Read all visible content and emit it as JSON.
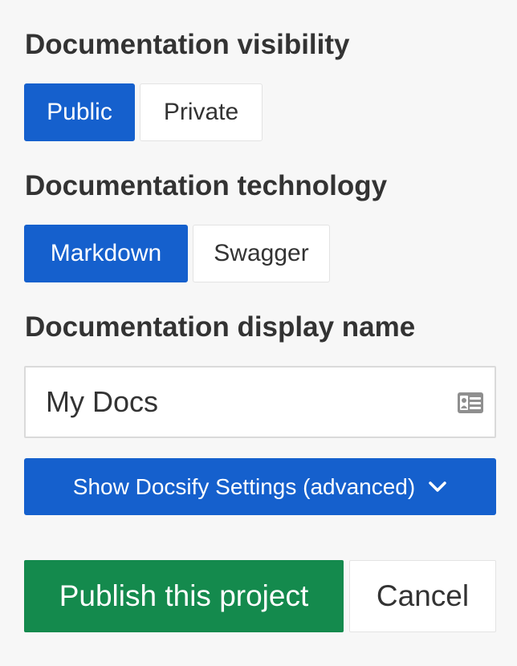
{
  "visibility": {
    "heading": "Documentation visibility",
    "options": [
      {
        "label": "Public",
        "selected": true
      },
      {
        "label": "Private",
        "selected": false
      }
    ]
  },
  "technology": {
    "heading": "Documentation technology",
    "options": [
      {
        "label": "Markdown",
        "selected": true
      },
      {
        "label": "Swagger",
        "selected": false
      }
    ]
  },
  "display_name": {
    "heading": "Documentation display name",
    "value": "My Docs",
    "icon": "id-card-icon"
  },
  "docsify": {
    "label": "Show Docsify Settings (advanced)",
    "icon": "chevron-down-icon"
  },
  "actions": {
    "publish_label": "Publish this project",
    "cancel_label": "Cancel"
  },
  "colors": {
    "primary": "#1560cd",
    "success": "#148a4d",
    "background": "#f7f7f7",
    "text": "#333333"
  }
}
